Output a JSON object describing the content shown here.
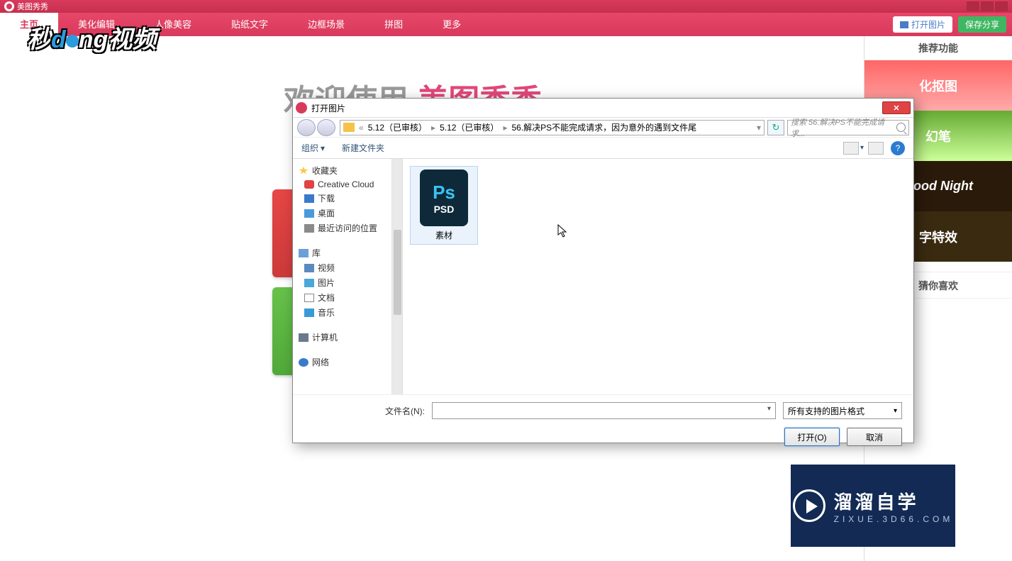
{
  "titleBar": {
    "appName": "美图秀秀"
  },
  "nav": {
    "tabs": [
      "主页",
      "美化编辑",
      "人像美容",
      "贴纸文字",
      "边框场景",
      "拼图",
      "更多"
    ],
    "openBtn": "打开图片",
    "saveBtn": "保存分享"
  },
  "welcome": {
    "gray": "欢迎使用",
    "pink": "美图秀秀"
  },
  "side": {
    "head1": "推荐功能",
    "promos": [
      "化抠图",
      "幻笔",
      "Good Night",
      "字特效"
    ],
    "head2": "猜你喜欢"
  },
  "dialog": {
    "title": "打开图片",
    "path": {
      "seg1": "5.12（已审核）",
      "seg2": "5.12（已审核）",
      "seg3": "56.解决PS不能完成请求，因为意外的遇到文件尾"
    },
    "searchPlaceholder": "搜索 56.解决PS不能完成请求...",
    "toolbar": {
      "organize": "组织",
      "newFolder": "新建文件夹"
    },
    "tree": {
      "favorites": "收藏夹",
      "cc": "Creative Cloud",
      "downloads": "下载",
      "desktop": "桌面",
      "recent": "最近访问的位置",
      "libraries": "库",
      "videos": "视频",
      "pictures": "图片",
      "documents": "文档",
      "music": "音乐",
      "computer": "计算机",
      "network": "网络"
    },
    "file": {
      "name": "素材",
      "iconBig": "Ps",
      "iconSmall": "PSD"
    },
    "bottom": {
      "fileLabel": "文件名(N):",
      "filter": "所有支持的图片格式",
      "open": "打开(O)",
      "cancel": "取消"
    }
  },
  "wmLogo": {
    "t1": "秒",
    "t2": "d",
    "t3": "ng",
    "t4": "视频"
  },
  "brand": {
    "cn": "溜溜自学",
    "en": "ZIXUE.3D66.COM"
  }
}
